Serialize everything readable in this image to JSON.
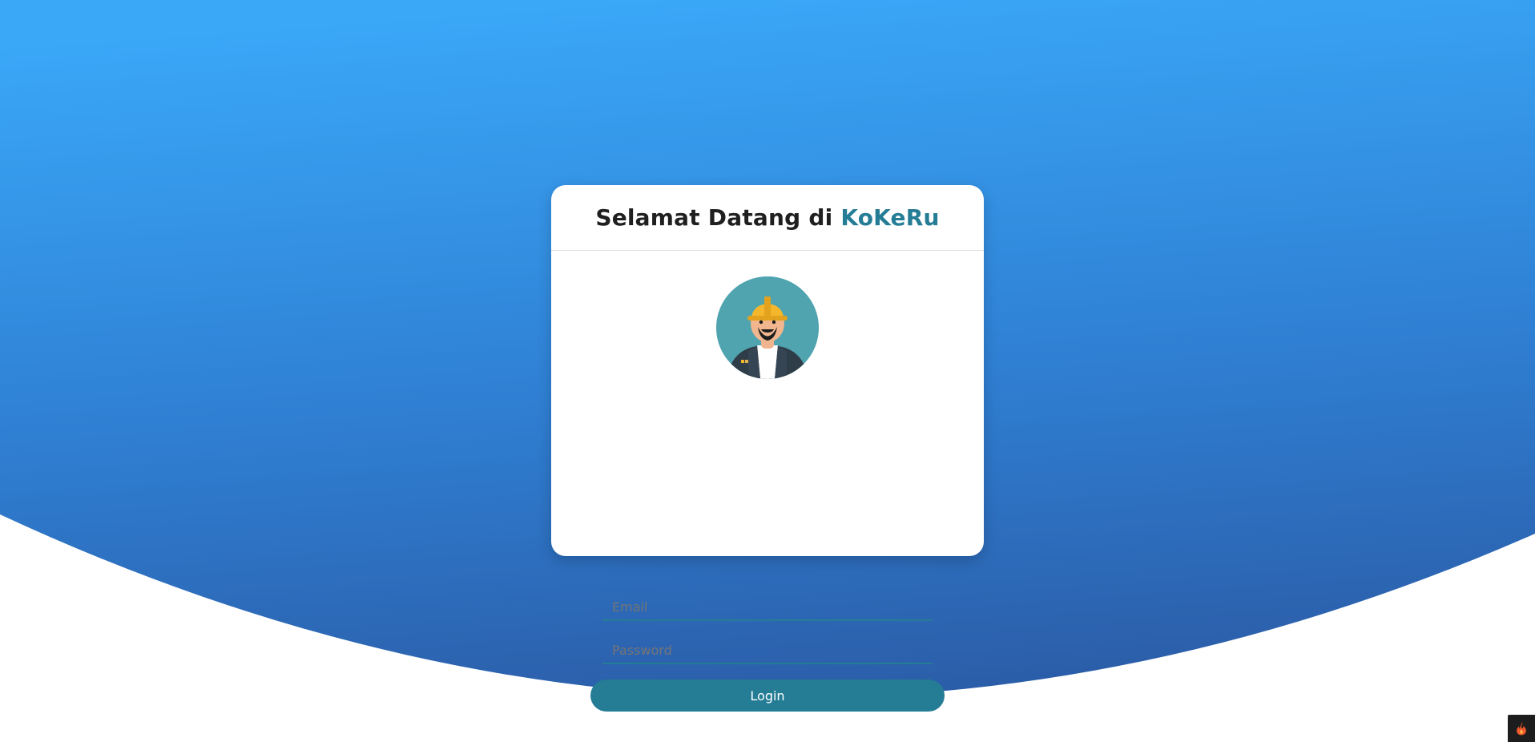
{
  "page": {
    "background_top_color": "#3aa7f7",
    "background_bottom_color": "#2b5da8"
  },
  "login": {
    "title_prefix": "Selamat Datang di ",
    "title_brand": "KoKeRu",
    "brand_color": "#247c95",
    "avatar_icon": "construction-worker-avatar",
    "email_placeholder": "Email",
    "password_placeholder": "Password",
    "login_button_label": "Login",
    "accent_color": "#247c95"
  },
  "debug_toolbar": {
    "icon": "flame-icon"
  }
}
